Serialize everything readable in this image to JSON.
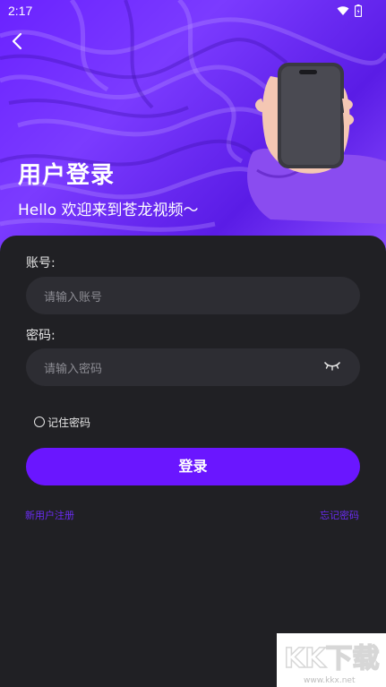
{
  "status_bar": {
    "time": "2:17"
  },
  "header": {
    "title": "用户登录",
    "subtitle": "Hello 欢迎来到苍龙视频～"
  },
  "form": {
    "account_label": "账号:",
    "account_placeholder": "请输入账号",
    "password_label": "密码:",
    "password_placeholder": "请输入密码",
    "remember_label": "记住密码",
    "login_label": "登录",
    "register_link": "新用户注册",
    "forgot_link": "忘记密码"
  },
  "watermark": {
    "text": "KK下载",
    "url": "www.kkx.net"
  },
  "colors": {
    "brand": "#6a16ff",
    "link": "#6a2cf2",
    "background": "#202024",
    "input": "#2d2d33"
  },
  "icons": [
    "back-arrow-icon",
    "wifi-icon",
    "battery-icon",
    "eye-closed-icon",
    "radio-icon"
  ]
}
